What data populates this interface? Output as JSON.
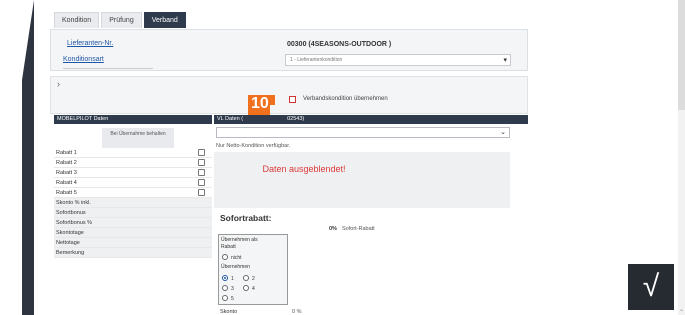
{
  "tabs": [
    "Kondition",
    "Prüfung",
    "Verband"
  ],
  "header": {
    "supplier_label": "Lieferanten-Nr.",
    "supplier_value": "00300 (4SEASONS-OUTDOOR )",
    "condition_label": "Konditionsart",
    "condition_value": "1 - Lieferantenkondition"
  },
  "badge_text": "10",
  "verband_checkbox_label": "Verbandskondition übernehmen",
  "left_section": {
    "title": "MOBELPILOT Daten",
    "column_header": "Bei Übernahme behalten",
    "rows": [
      "Rabatt 1",
      "Rabatt 2",
      "Rabatt 3",
      "Rabatt 4",
      "Rabatt 5",
      "Skonto % inkl.",
      "Sofortbonus",
      "Sofortbonus %",
      "Skontotage",
      "Nettotage",
      "Bemerkung"
    ]
  },
  "right_section": {
    "title_prefix": "VL Daten (",
    "title_suffix": "02543)",
    "note": "Nur Netto-Kondition verfügbar.",
    "hidden_message": "Daten ausgeblendet!",
    "sofort_title": "Sofortrabatt:",
    "sofort_percent": "0%",
    "sofort_label": "Sofort-Rabatt",
    "options": {
      "heading": "Übernehmen als Rabatt",
      "nicht": "nicht",
      "uebernehmen": "Übernehmen",
      "numbers": [
        "1",
        "2",
        "3",
        "4",
        "5"
      ]
    },
    "skonto_label": "Skonto",
    "skonto_percent": "0 %"
  },
  "confirm_symbol": "√",
  "colors": {
    "accent": "#2f3b4c",
    "badge": "#f0701e",
    "error": "#dd3a3a",
    "link": "#1f56a8"
  }
}
